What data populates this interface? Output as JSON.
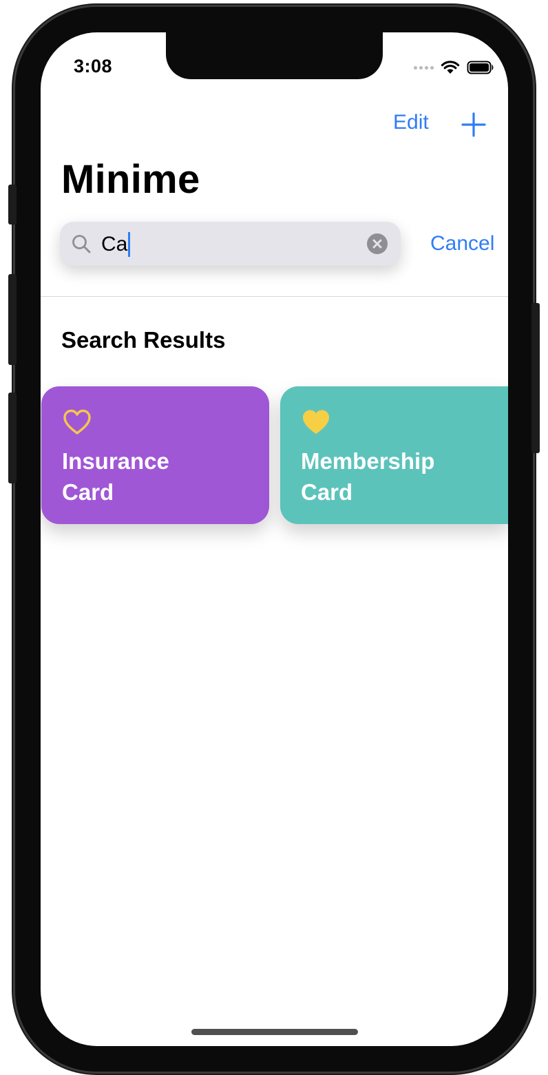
{
  "status_bar": {
    "time": "3:08",
    "wifi_icon": "wifi-icon",
    "battery_icon": "battery-icon"
  },
  "nav": {
    "edit_label": "Edit",
    "add_icon": "plus-icon"
  },
  "title": "Minime",
  "search": {
    "value": "Ca",
    "cancel_label": "Cancel",
    "search_icon": "magnifier-icon",
    "clear_icon": "clear-circle-icon"
  },
  "section_title": "Search Results",
  "cards": [
    {
      "label_line1": "Insurance",
      "label_line2": "Card",
      "favorite": false,
      "color": "#a057d6",
      "heart_color": "#f5c84a"
    },
    {
      "label_line1": "Membership",
      "label_line2": "Card",
      "favorite": true,
      "color": "#5cc3bb",
      "heart_color": "#f7cf45"
    }
  ],
  "colors": {
    "accent": "#2f7cf6",
    "search_bg": "#e4e4ea"
  }
}
